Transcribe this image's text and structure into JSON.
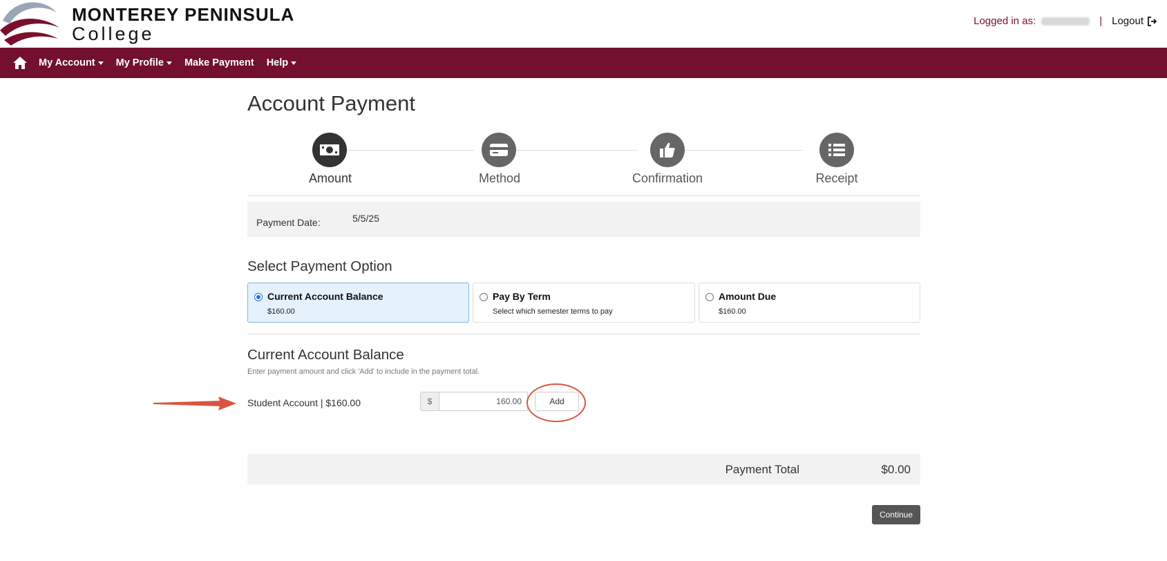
{
  "header": {
    "logo_line1": "MONTEREY PENINSULA",
    "logo_line2": "College",
    "logged_in_label": "Logged in as:",
    "separator": "|",
    "logout_label": "Logout"
  },
  "nav": {
    "items": [
      {
        "label": "My Account",
        "dropdown": true
      },
      {
        "label": "My Profile",
        "dropdown": true
      },
      {
        "label": "Make Payment",
        "dropdown": false
      },
      {
        "label": "Help",
        "dropdown": true
      }
    ]
  },
  "page": {
    "title": "Account Payment"
  },
  "steps": [
    {
      "label": "Amount",
      "icon": "money-icon",
      "active": true
    },
    {
      "label": "Method",
      "icon": "credit-card-icon",
      "active": false
    },
    {
      "label": "Confirmation",
      "icon": "thumbs-up-icon",
      "active": false
    },
    {
      "label": "Receipt",
      "icon": "list-icon",
      "active": false
    }
  ],
  "payment_date": {
    "label": "Payment Date:",
    "value": "5/5/25"
  },
  "payment_option": {
    "title": "Select Payment Option",
    "options": [
      {
        "title": "Current Account Balance",
        "sub": "$160.00",
        "selected": true
      },
      {
        "title": "Pay By Term",
        "sub": "Select which semester terms to pay",
        "selected": false
      },
      {
        "title": "Amount Due",
        "sub": "$160.00",
        "selected": false
      }
    ]
  },
  "balance": {
    "title": "Current Account Balance",
    "hint": "Enter payment amount and click 'Add' to include in the payment total.",
    "account_label": "Student Account | $160.00",
    "currency_symbol": "$",
    "amount_value": "160.00",
    "add_label": "Add"
  },
  "total": {
    "label": "Payment Total",
    "value": "$0.00"
  },
  "continue_label": "Continue",
  "colors": {
    "brand": "#72102d",
    "annotation": "#d8553f",
    "selected_bg": "#e5f1fb"
  }
}
